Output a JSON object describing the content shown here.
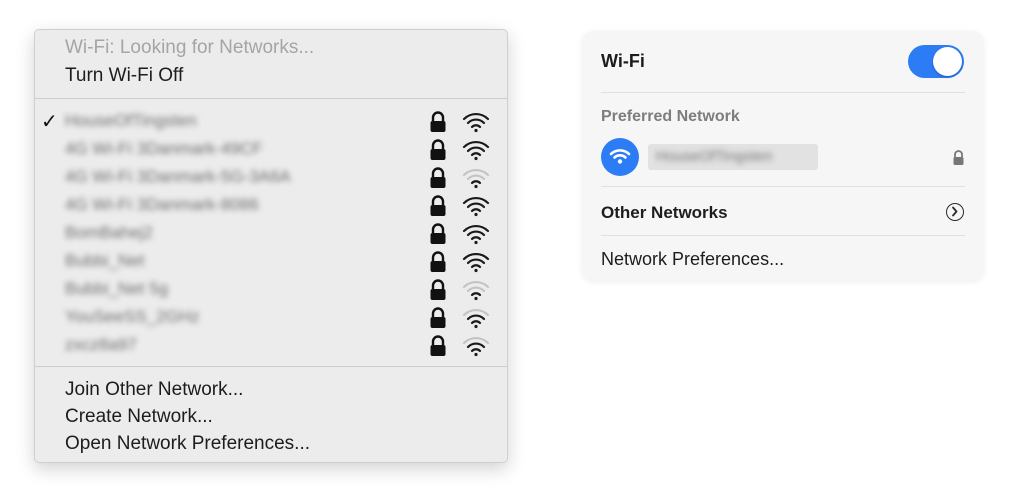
{
  "menu": {
    "status": "Wi-Fi: Looking for Networks...",
    "turn_off": "Turn Wi-Fi Off",
    "networks": [
      {
        "name": "HouseOfTingsten",
        "selected": true,
        "signal": 4
      },
      {
        "name": "4G Wi-Fi 3Danmark-49CF",
        "selected": false,
        "signal": 4
      },
      {
        "name": "4G Wi-Fi 3Danmark-5G-3A6A",
        "selected": false,
        "signal": 2
      },
      {
        "name": "4G Wi-Fi 3Danmark-8086",
        "selected": false,
        "signal": 4
      },
      {
        "name": "BomBahej2",
        "selected": false,
        "signal": 4
      },
      {
        "name": "Bubbi_Net",
        "selected": false,
        "signal": 4
      },
      {
        "name": "Bubbi_Net 5g",
        "selected": false,
        "signal": 2
      },
      {
        "name": "YouSeeSS_2GHz",
        "selected": false,
        "signal": 3
      },
      {
        "name": "zxcz8a97",
        "selected": false,
        "signal": 3
      }
    ],
    "check_glyph": "✓",
    "join_other": "Join Other Network...",
    "create_network": "Create Network...",
    "open_prefs": "Open Network Preferences..."
  },
  "panel": {
    "title": "Wi-Fi",
    "wifi_on": true,
    "preferred_label": "Preferred Network",
    "preferred_network": "HouseOfTingsten",
    "other_networks": "Other Networks",
    "network_prefs": "Network Preferences...",
    "accent_color": "#2c7cf6"
  },
  "icons": {
    "lock": "lock-icon",
    "wifi": "wifi-signal-icon",
    "chevron": "chevron-right-circle-icon"
  }
}
